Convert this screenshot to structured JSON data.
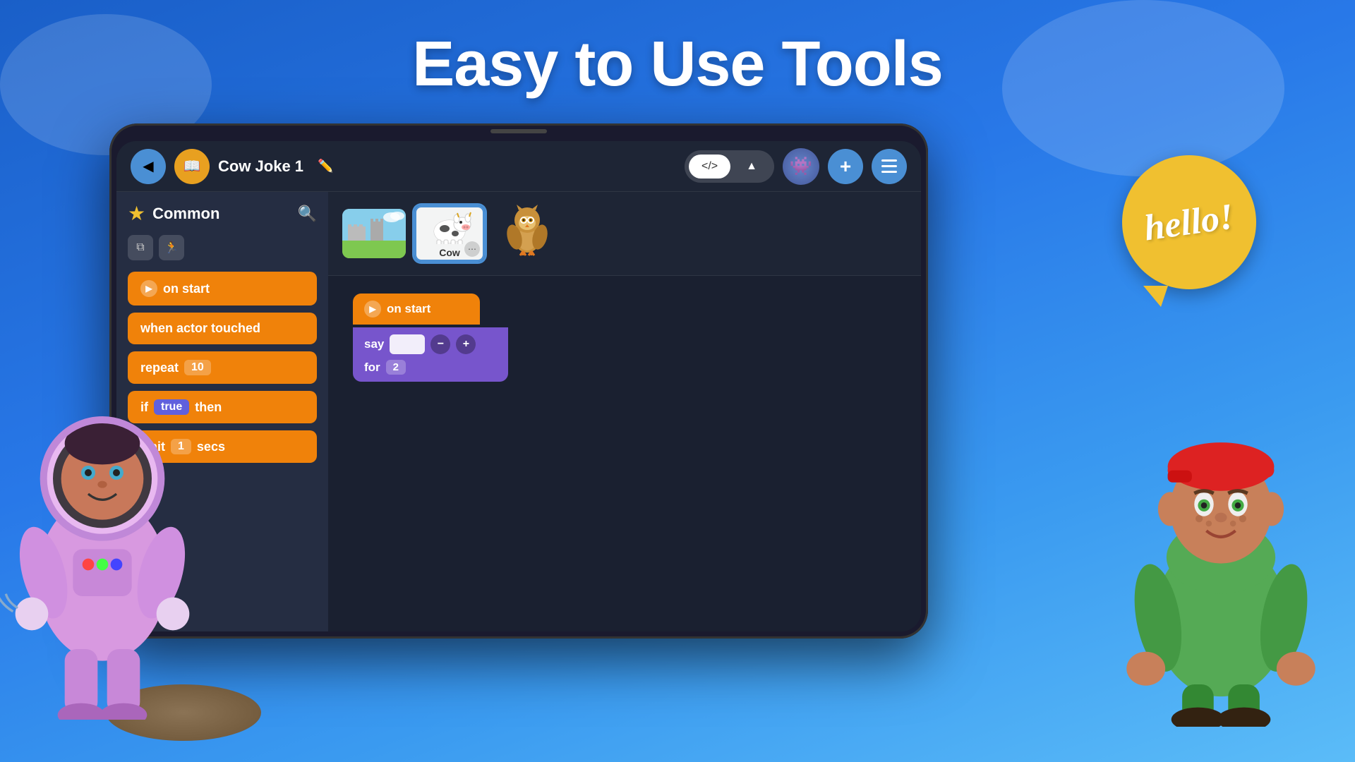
{
  "page": {
    "title": "Easy to Use Tools",
    "background_gradient_start": "#1a5fc8",
    "background_gradient_end": "#5bbcf8"
  },
  "navbar": {
    "back_label": "◀",
    "book_icon": "📖",
    "project_title": "Cow Joke 1",
    "edit_icon": "✏️",
    "code_view_label": "</>",
    "scene_view_label": "🏔",
    "plus_label": "+",
    "menu_label": "☰"
  },
  "sidebar": {
    "category": "Common",
    "star_icon": "★",
    "search_icon": "🔍",
    "blocks": [
      {
        "type": "on_start",
        "label": "on start",
        "color": "orange"
      },
      {
        "type": "when_actor_touched",
        "label": "when actor touched",
        "color": "orange"
      },
      {
        "type": "repeat",
        "label": "repeat",
        "value": "10",
        "color": "orange"
      },
      {
        "type": "if_true_then",
        "label": "if",
        "condition": "true",
        "suffix": "then",
        "color": "orange"
      },
      {
        "type": "wait_secs",
        "label": "wait",
        "value": "1",
        "suffix": "secs",
        "color": "orange"
      }
    ]
  },
  "scene": {
    "background_thumb_alt": "Castle background",
    "sprites": [
      {
        "id": "cow",
        "label": "Cow",
        "selected": true,
        "emoji": "🐄"
      },
      {
        "id": "bird",
        "label": "Bird",
        "emoji": "🦅"
      }
    ]
  },
  "canvas": {
    "blocks": [
      {
        "type": "on_start",
        "label": "on start"
      },
      {
        "type": "say_for",
        "say_label": "say",
        "minus_label": "−",
        "plus_label": "+",
        "for_label": "for",
        "value": "2"
      }
    ]
  },
  "hello_bubble": {
    "text": "hello!",
    "bg_color": "#f0c030"
  },
  "characters": {
    "astronaut_alt": "Astronaut character",
    "boy_alt": "Boy character"
  }
}
